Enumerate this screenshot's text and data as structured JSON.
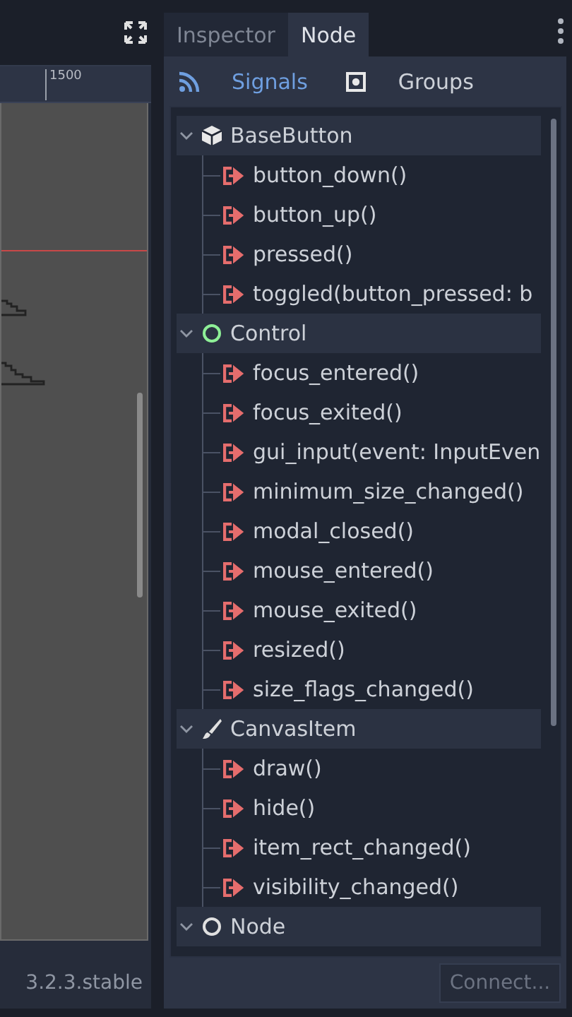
{
  "viewport": {
    "ruler_label": "1500",
    "version": "3.2.3.stable"
  },
  "dock_tabs": [
    {
      "label": "Inspector",
      "selected": false
    },
    {
      "label": "Node",
      "selected": true
    }
  ],
  "sub_tabs": [
    {
      "label": "Signals",
      "kind": "signals",
      "selected": true
    },
    {
      "label": "Groups",
      "kind": "groups",
      "selected": false
    }
  ],
  "tree": [
    {
      "label": "BaseButton",
      "kind": "base_button",
      "expanded": true,
      "children": [
        "button_down()",
        "button_up()",
        "pressed()",
        "toggled(button_pressed: b"
      ]
    },
    {
      "label": "Control",
      "kind": "control",
      "expanded": true,
      "children": [
        "focus_entered()",
        "focus_exited()",
        "gui_input(event: InputEven",
        "minimum_size_changed()",
        "modal_closed()",
        "mouse_entered()",
        "mouse_exited()",
        "resized()",
        "size_flags_changed()"
      ]
    },
    {
      "label": "CanvasItem",
      "kind": "canvas_item",
      "expanded": true,
      "children": [
        "draw()",
        "hide()",
        "item_rect_changed()",
        "visibility_changed()"
      ]
    },
    {
      "label": "Node",
      "kind": "node",
      "expanded": true
    }
  ],
  "connect_button": {
    "label": "Connect...",
    "disabled": true
  }
}
